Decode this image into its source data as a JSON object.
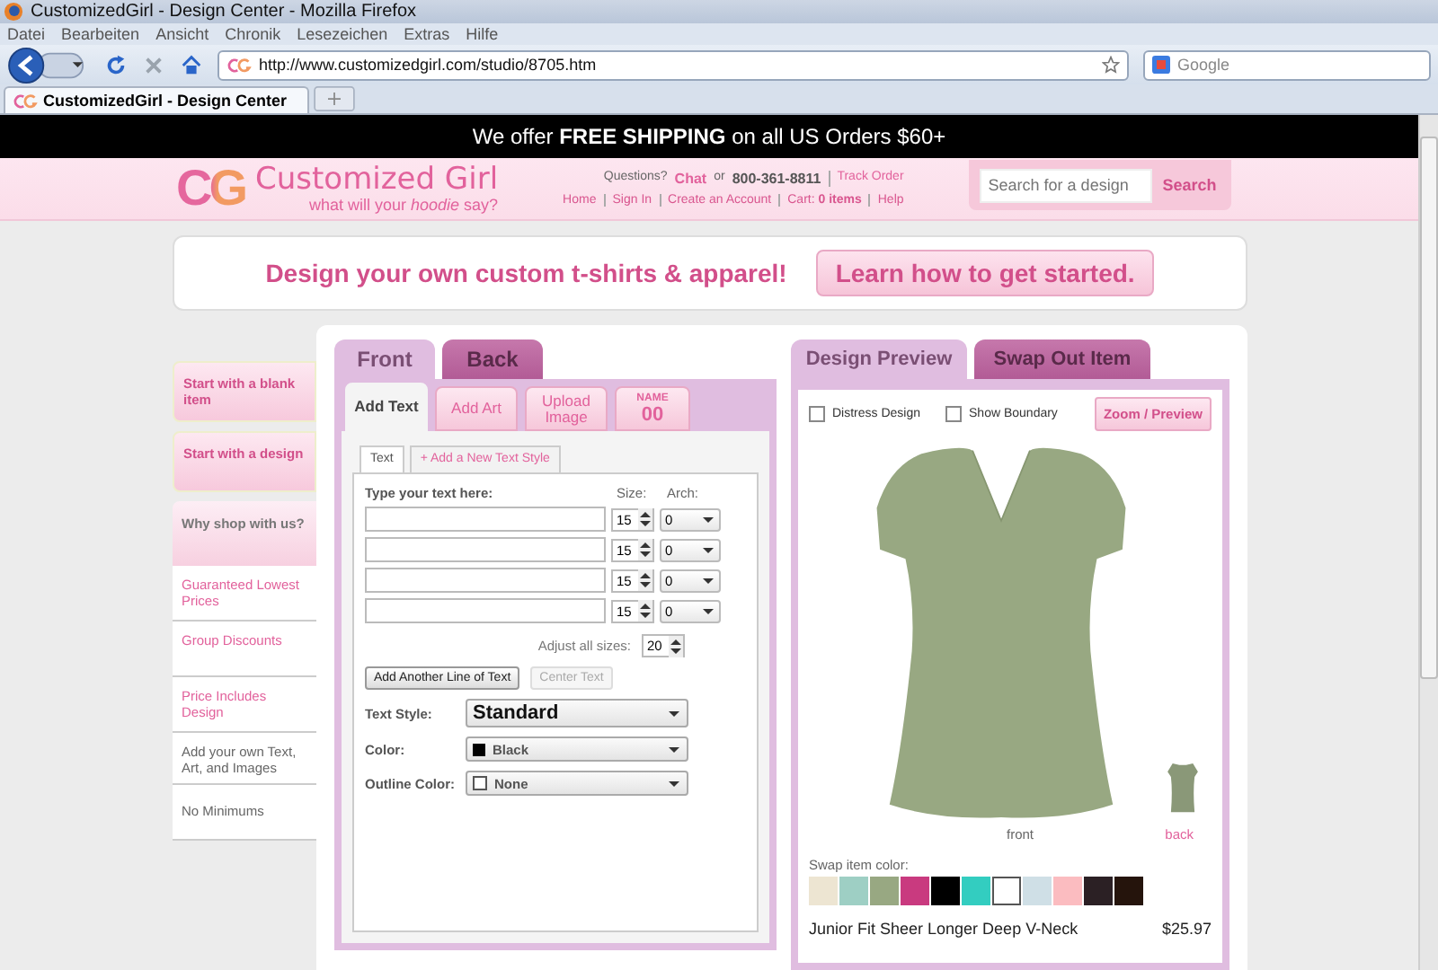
{
  "window": {
    "title": "CustomizedGirl - Design Center - Mozilla Firefox"
  },
  "menu": [
    "Datei",
    "Bearbeiten",
    "Ansicht",
    "Chronik",
    "Lesezeichen",
    "Extras",
    "Hilfe"
  ],
  "address_bar": {
    "url": "http://www.customizedgirl.com/studio/8705.htm",
    "search_placeholder": "Google"
  },
  "browser_tabs": [
    {
      "label": "CustomizedGirl - Design Center",
      "selected": true
    }
  ],
  "banner": "We offer **FREE SHIPPING** on all US Orders $60+",
  "header": {
    "logo_mark": "CG",
    "logo_name": "Customized Girl",
    "tagline": "what will your *hoodie* say?",
    "contact": [
      {
        "text": "Questions?",
        "kind": "text"
      },
      {
        "text": "Chat",
        "kind": "link"
      },
      {
        "text": "or",
        "kind": "text"
      },
      {
        "text": "800-361-8811",
        "kind": "phone"
      },
      {
        "text": "Track Order",
        "kind": "link"
      }
    ],
    "links": [
      "Home",
      "Sign In",
      "Create an Account",
      "Cart: **0 items**",
      "Help"
    ],
    "search": {
      "placeholder": "Search for a design",
      "button": "Search"
    }
  },
  "intro": {
    "headline": "Design your own custom t-shirts & apparel!",
    "button": "Learn how to get started."
  },
  "sidebar": [
    {
      "kind": "button",
      "label": "Start with a blank item"
    },
    {
      "kind": "button",
      "label": "Start with a design"
    },
    {
      "kind": "heading",
      "label": "Why shop with us?"
    },
    {
      "kind": "link",
      "label": "Guaranteed Lowest Prices"
    },
    {
      "kind": "link",
      "label": "Group Discounts"
    },
    {
      "kind": "link",
      "label": "Price Includes Design"
    },
    {
      "kind": "text",
      "label": "Add your own Text, Art, and Images"
    },
    {
      "kind": "text",
      "label": "No Minimums"
    }
  ],
  "side_tabs": [
    {
      "label": "Front",
      "selected": true
    },
    {
      "label": "Back",
      "selected": false
    }
  ],
  "tool_tabs": [
    {
      "kind": "text",
      "label": "Add Text",
      "selected": true
    },
    {
      "kind": "text",
      "label": "Add Art",
      "selected": false
    },
    {
      "kind": "text",
      "label": "Upload Image",
      "selected": false
    },
    {
      "kind": "name",
      "label": "NAME",
      "sublabel": "00",
      "selected": false
    }
  ],
  "text_tabs": [
    {
      "label": "Text",
      "selected": true
    },
    {
      "label": "+ Add a New Text Style",
      "selected": false
    }
  ],
  "text_form": {
    "heading": "Type your text here:",
    "size_label": "Size:",
    "arch_label": "Arch:",
    "lines": [
      {
        "size": "15",
        "arch": "0"
      },
      {
        "size": "15",
        "arch": "0"
      },
      {
        "size": "15",
        "arch": "0"
      },
      {
        "size": "15",
        "arch": "0"
      }
    ],
    "adjust_label": "Adjust all sizes:",
    "adjust_value": "20",
    "buttons": [
      {
        "label": "Add Another Line of Text",
        "disabled": false
      },
      {
        "label": "Center Text",
        "disabled": true
      }
    ],
    "style_label": "Text Style:",
    "style_value": "Standard",
    "color_label": "Color:",
    "color_value": "Black",
    "outline_label": "Outline Color:",
    "outline_value": "None"
  },
  "preview_tabs": [
    {
      "label": "Design Preview",
      "selected": true
    },
    {
      "label": "Swap Out Item",
      "selected": false
    }
  ],
  "preview": {
    "options": [
      {
        "label": "Distress Design",
        "checked": false
      },
      {
        "label": "Show Boundary",
        "checked": false
      }
    ],
    "zoom_button": "Zoom / Preview",
    "views": [
      {
        "label": "front",
        "selected": true
      },
      {
        "label": "back",
        "selected": false
      }
    ],
    "swatch_label": "Swap item color:",
    "swatches": [
      {
        "color": "#ede5d2",
        "selected": false
      },
      {
        "color": "#9ecfc4",
        "selected": false
      },
      {
        "color": "#98a882",
        "selected": false
      },
      {
        "color": "#c93a7f",
        "selected": false
      },
      {
        "color": "#000000",
        "selected": false
      },
      {
        "color": "#33cdc0",
        "selected": false
      },
      {
        "color": "#ffffff",
        "selected": true
      },
      {
        "color": "#cfdfe6",
        "selected": false
      },
      {
        "color": "#fbbcc0",
        "selected": false
      },
      {
        "color": "#2b2024",
        "selected": false
      },
      {
        "color": "#25140c",
        "selected": false
      }
    ],
    "product_name": "Junior Fit Sheer Longer Deep V-Neck",
    "price": "$25.97"
  }
}
